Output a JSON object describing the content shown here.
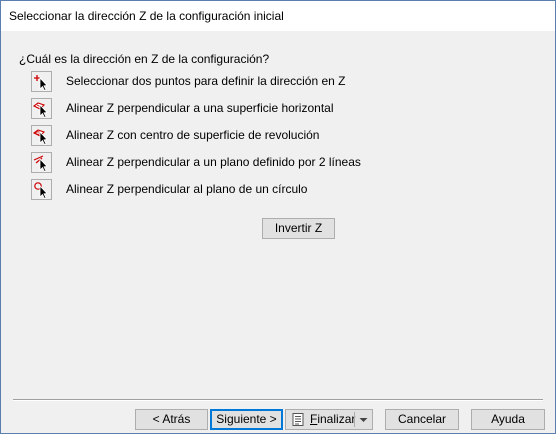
{
  "window": {
    "title": "Seleccionar la dirección Z de la configuración inicial"
  },
  "question": "¿Cuál es la dirección en Z de la configuración?",
  "options": [
    {
      "label": "Seleccionar dos puntos para definir la dirección en Z",
      "icon": "pick-two-points-icon"
    },
    {
      "label": "Alinear Z perpendicular a una superficie horizontal",
      "icon": "horizontal-surface-icon"
    },
    {
      "label": "Alinear Z con centro de superficie de revolución",
      "icon": "revolution-surface-icon"
    },
    {
      "label": "Alinear Z perpendicular a un plano definido por 2 líneas",
      "icon": "two-lines-plane-icon"
    },
    {
      "label": "Alinear Z perpendicular al plano de un círculo",
      "icon": "circle-plane-icon"
    }
  ],
  "invert_button": "Invertir Z",
  "footer": {
    "back": "< Atrás",
    "next": "Siguiente >",
    "finish_first": "F",
    "finish_rest": "inalizar",
    "cancel": "Cancelar",
    "help": "Ayuda"
  },
  "colors": {
    "accent_border": "#0078d7",
    "icon_red": "#cc0000"
  }
}
